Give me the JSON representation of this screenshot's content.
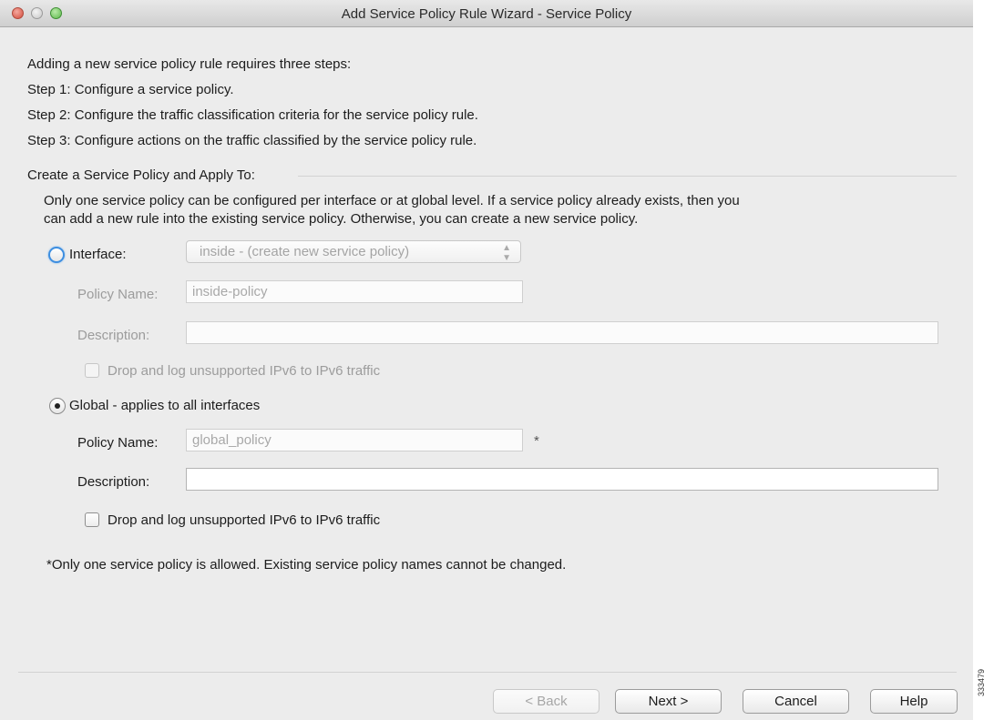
{
  "window": {
    "title": "Add Service Policy Rule Wizard - Service Policy"
  },
  "intro": {
    "line1": "Adding a new service policy rule requires three steps:",
    "step1": "Step 1:  Configure a service policy.",
    "step2": "Step 2:  Configure the traffic classification criteria for the service policy rule.",
    "step3": "Step 3:  Configure actions on the traffic classified by the service policy rule."
  },
  "section": {
    "heading": "Create a Service Policy and Apply To:",
    "desc_line1": "Only one service policy can be configured per interface or at global level. If a service policy already exists, then you",
    "desc_line2": "can add a new rule into the existing service policy. Otherwise, you can create a new service policy."
  },
  "interface_option": {
    "label": "Interface:",
    "selected": false,
    "select_value": "inside - (create new service policy)",
    "policy_name_label": "Policy Name:",
    "policy_name_value": "inside-policy",
    "description_label": "Description:",
    "description_value": "",
    "drop_log_label": "Drop and log unsupported IPv6 to IPv6 traffic",
    "drop_log_checked": false
  },
  "global_option": {
    "label": "Global - applies to all interfaces",
    "selected": true,
    "policy_name_label": "Policy Name:",
    "policy_name_value": "global_policy",
    "required_marker": "*",
    "description_label": "Description:",
    "description_value": "",
    "drop_log_label": "Drop and log unsupported IPv6 to IPv6 traffic",
    "drop_log_checked": false
  },
  "footnote": "*Only one service policy is allowed. Existing service policy names cannot be changed.",
  "buttons": {
    "back": "< Back",
    "next": "Next >",
    "cancel": "Cancel",
    "help": "Help"
  },
  "figure_id": "333479"
}
